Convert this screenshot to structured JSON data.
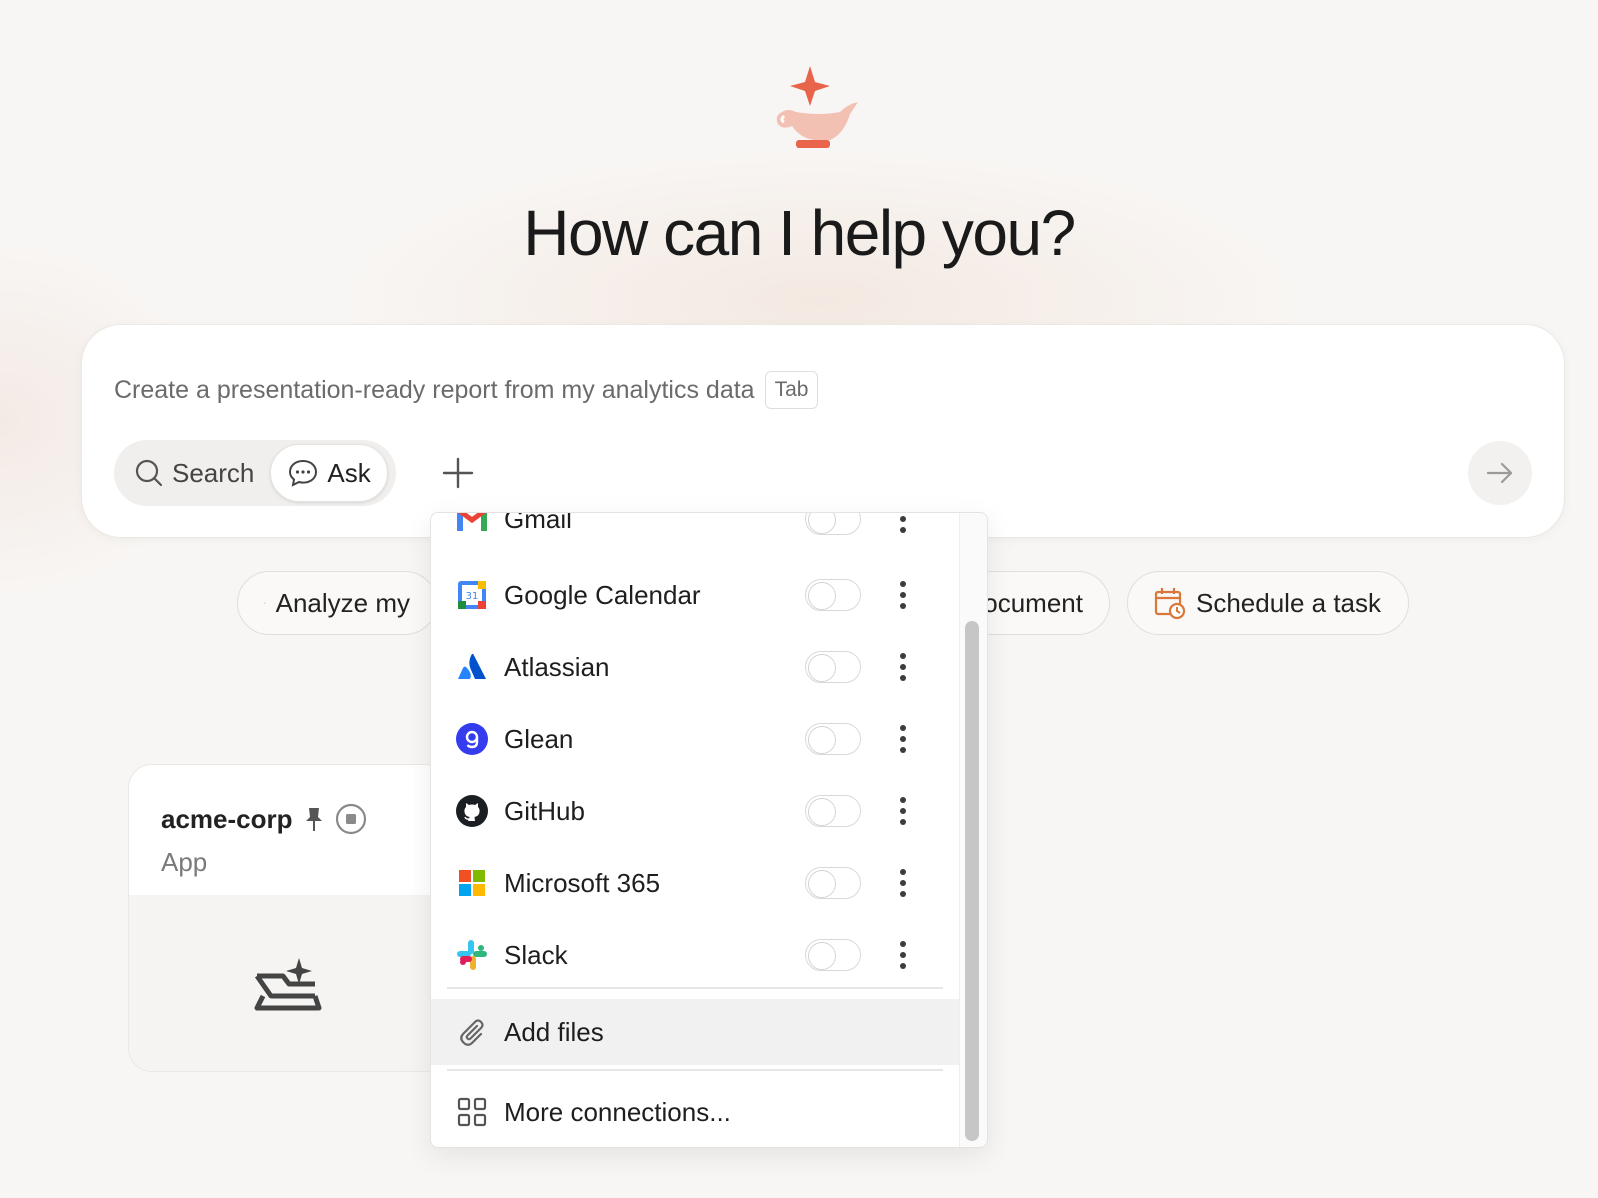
{
  "headline": "How can I help you?",
  "composer": {
    "placeholder": "Create a presentation-ready report from my analytics data",
    "tab_hint": "Tab",
    "modes": [
      {
        "label": "Search",
        "icon": "search-icon",
        "active": false
      },
      {
        "label": "Ask",
        "icon": "chat-bubble-icon",
        "active": true
      }
    ]
  },
  "chips": [
    {
      "label": "Analyze my",
      "icon": "bar-chart-icon"
    },
    {
      "label": "ocument",
      "icon": "none"
    },
    {
      "label": "Schedule a task",
      "icon": "calendar-clock-icon"
    }
  ],
  "project_card": {
    "title": "acme-corp",
    "subtitle": "App"
  },
  "connections_menu": {
    "partial_item": "Gmail",
    "items": [
      {
        "label": "Google Calendar",
        "icon": "google-calendar-icon"
      },
      {
        "label": "Atlassian",
        "icon": "atlassian-icon"
      },
      {
        "label": "Glean",
        "icon": "glean-icon"
      },
      {
        "label": "GitHub",
        "icon": "github-icon"
      },
      {
        "label": "Microsoft 365",
        "icon": "microsoft-icon"
      },
      {
        "label": "Slack",
        "icon": "slack-icon"
      }
    ],
    "add_files": "Add files",
    "more_connections": "More connections..."
  },
  "colors": {
    "accent": "#e8644a",
    "accent_light": "#f3c0b4",
    "schedule_icon": "#d9783a",
    "analyze_icon": "#4a8fd6"
  }
}
